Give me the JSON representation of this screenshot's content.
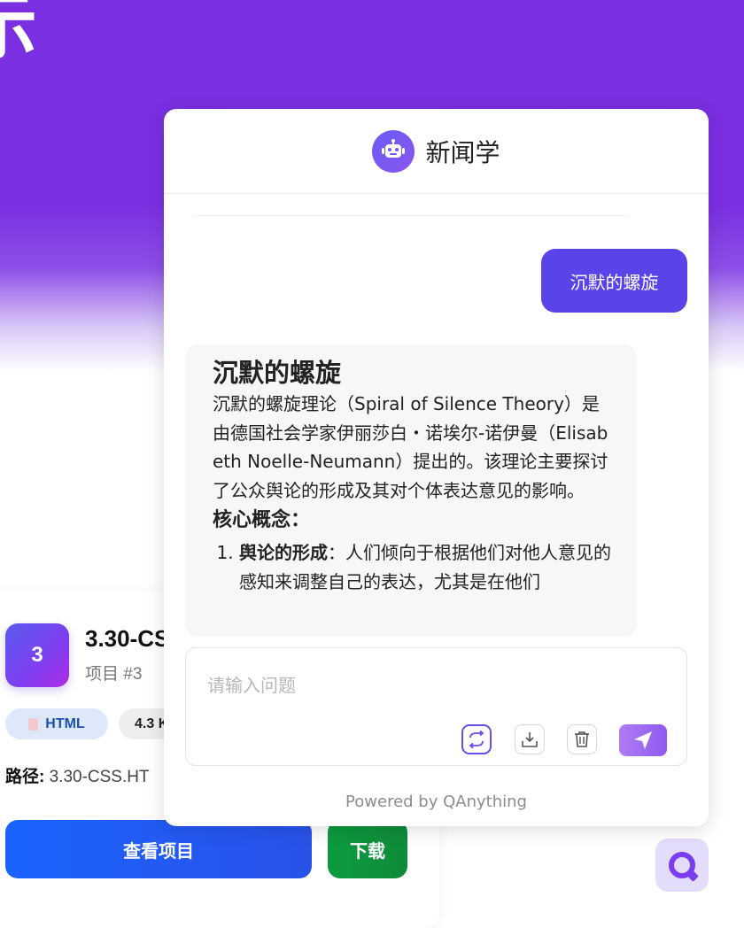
{
  "hero": {
    "title": "示"
  },
  "project": {
    "icon_text": "3",
    "title": "3.30-CS",
    "subtitle": "项目 #3",
    "tag_type": "HTML",
    "tag_size": "4.3 K",
    "path_label": "路径:",
    "path_value": "3.30-CSS.HT",
    "view_button": "查看项目",
    "download_button": "下载"
  },
  "chat": {
    "title": "新闻学",
    "user_message": "沉默的螺旋",
    "answer": {
      "heading": "沉默的螺旋",
      "paragraph": "沉默的螺旋理论（Spiral of Silence Theory）是由德国社会学家伊丽莎白・诺埃尔-诺伊曼（Elisabeth Noelle-Neumann）提出的。该理论主要探讨了公众舆论的形成及其对个体表达意见的影响。",
      "subheading": "核心概念：",
      "items": [
        {
          "term": "舆论的形成",
          "text": "：人们倾向于根据他们对他人意见的感知来调整自己的表达，尤其是在他们"
        }
      ]
    },
    "input_placeholder": "请输入问题",
    "powered_by": "Powered by QAnything"
  },
  "colors": {
    "brand_purple": "#7a2fe0",
    "user_bubble": "#5a43e8",
    "view_button": "#1b63ff",
    "download_button": "#0d9b3e"
  },
  "icons": [
    "robot-icon",
    "switch-icon",
    "download-icon",
    "trash-icon",
    "send-icon",
    "qanything-logo-icon",
    "file-icon"
  ]
}
